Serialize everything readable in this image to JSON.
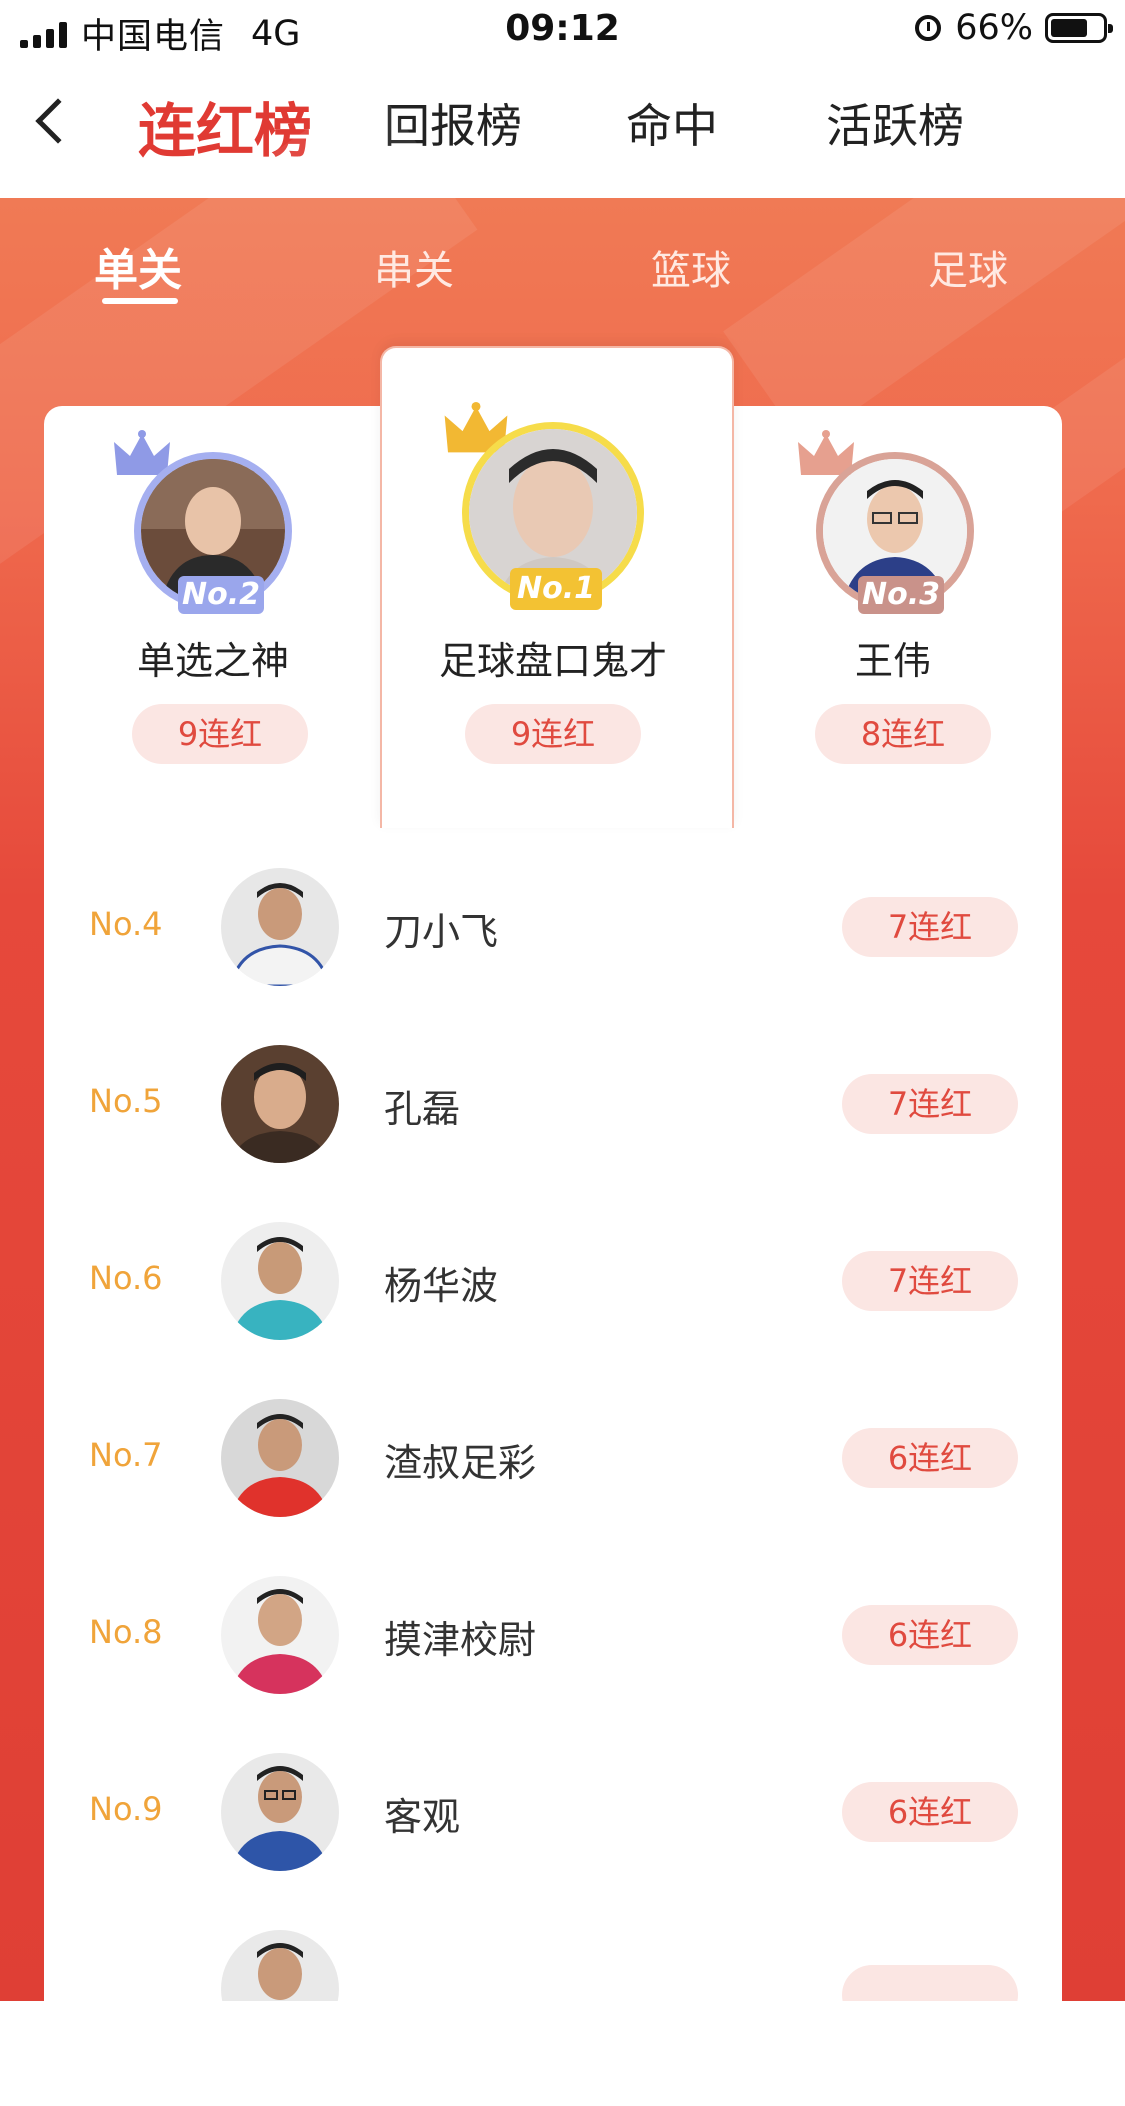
{
  "status_bar": {
    "carrier": "中国电信",
    "network": "4G",
    "time": "09:12",
    "battery": "66%",
    "battery_level": 0.66
  },
  "nav": {
    "tabs": [
      "连红榜",
      "回报榜",
      "命中",
      "活跃榜"
    ],
    "active_tab": "连红榜"
  },
  "sub_tabs": {
    "items": [
      "单关",
      "串关",
      "篮球",
      "足球"
    ],
    "active": "单关"
  },
  "podium": [
    {
      "rank": "No.2",
      "name": "单选之神",
      "streak": "9连红",
      "ring_color": "#a5aff0",
      "crown_color": "#8f9ae6"
    },
    {
      "rank": "No.1",
      "name": "足球盘口鬼才",
      "streak": "9连红",
      "ring_color": "#f6dc4a",
      "crown_color": "#f2b833"
    },
    {
      "rank": "No.3",
      "name": "王伟",
      "streak": "8连红",
      "ring_color": "#d9a397",
      "crown_color": "#e6a08f"
    }
  ],
  "list": [
    {
      "rank": "No.4",
      "name": "刀小飞",
      "streak": "7连红",
      "shirt": "#f3f3f3"
    },
    {
      "rank": "No.5",
      "name": "孔磊",
      "streak": "7连红",
      "shirt": "#3a2b22"
    },
    {
      "rank": "No.6",
      "name": "杨华波",
      "streak": "7连红",
      "shirt": "#38b3c0"
    },
    {
      "rank": "No.7",
      "name": "渣叔足彩",
      "streak": "6连红",
      "shirt": "#e0322c"
    },
    {
      "rank": "No.8",
      "name": "摸津校尉",
      "streak": "6连红",
      "shirt": "#d6335d"
    },
    {
      "rank": "No.9",
      "name": "客观",
      "streak": "6连红",
      "shirt": "#2e55a8"
    }
  ],
  "colors": {
    "accent_red": "#e03a33",
    "rank_orange": "#f0a43a",
    "pill_bg": "#fbe6e3",
    "pill_text": "#e04a3f"
  }
}
